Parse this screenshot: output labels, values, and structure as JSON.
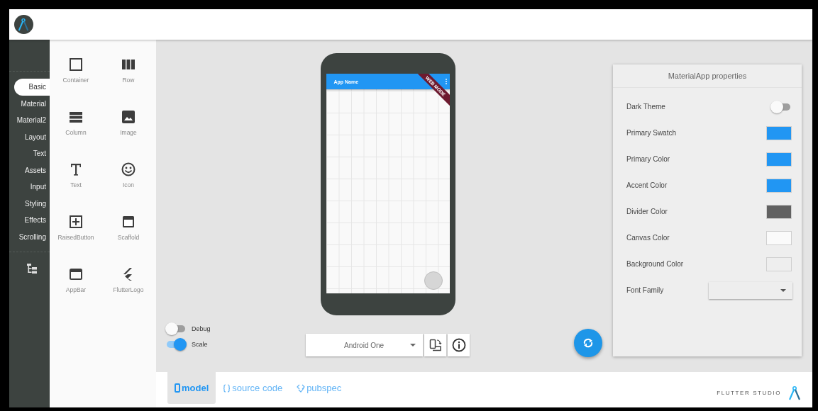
{
  "categories": [
    {
      "label": "Basic",
      "selected": true
    },
    {
      "label": "Material",
      "selected": false
    },
    {
      "label": "Material2",
      "selected": false
    },
    {
      "label": "Layout",
      "selected": false
    },
    {
      "label": "Text",
      "selected": false
    },
    {
      "label": "Assets",
      "selected": false
    },
    {
      "label": "Input",
      "selected": false
    },
    {
      "label": "Styling",
      "selected": false
    },
    {
      "label": "Effects",
      "selected": false
    },
    {
      "label": "Scrolling",
      "selected": false
    }
  ],
  "widgets": [
    {
      "label": "Container",
      "kind": "container"
    },
    {
      "label": "Row",
      "kind": "row"
    },
    {
      "label": "Column",
      "kind": "column"
    },
    {
      "label": "Image",
      "kind": "image"
    },
    {
      "label": "Text",
      "kind": "text"
    },
    {
      "label": "Icon",
      "kind": "icon"
    },
    {
      "label": "RaisedButton",
      "kind": "button"
    },
    {
      "label": "Scaffold",
      "kind": "scaffold"
    },
    {
      "label": "AppBar",
      "kind": "appbar"
    },
    {
      "label": "FlutterLogo",
      "kind": "logo"
    }
  ],
  "device": {
    "app_name": "App Name",
    "banner": "WEB MODE"
  },
  "toggles": [
    {
      "label": "Debug",
      "on": false
    },
    {
      "label": "Scale",
      "on": true
    }
  ],
  "device_select": {
    "value": "Android One"
  },
  "properties": {
    "title": "MaterialApp properties",
    "rows": [
      {
        "label": "Dark Theme",
        "kind": "switch",
        "on": false
      },
      {
        "label": "Primary Swatch",
        "kind": "color",
        "color": "#2196f3"
      },
      {
        "label": "Primary Color",
        "kind": "color",
        "color": "#2196f3"
      },
      {
        "label": "Accent Color",
        "kind": "color",
        "color": "#2196f3"
      },
      {
        "label": "Divider Color",
        "kind": "color",
        "color": "#616161"
      },
      {
        "label": "Canvas Color",
        "kind": "color",
        "color": "#fafafa"
      },
      {
        "label": "Background Color",
        "kind": "color",
        "color": "#eeeeee"
      },
      {
        "label": "Font Family",
        "kind": "dropdown"
      }
    ]
  },
  "tabs": [
    {
      "label": "model",
      "kind": "phone",
      "selected": true
    },
    {
      "label": "source code",
      "kind": "braces",
      "selected": false
    },
    {
      "label": "pubspec",
      "kind": "code",
      "selected": false
    }
  ],
  "brand": "FLUTTER STUDIO"
}
